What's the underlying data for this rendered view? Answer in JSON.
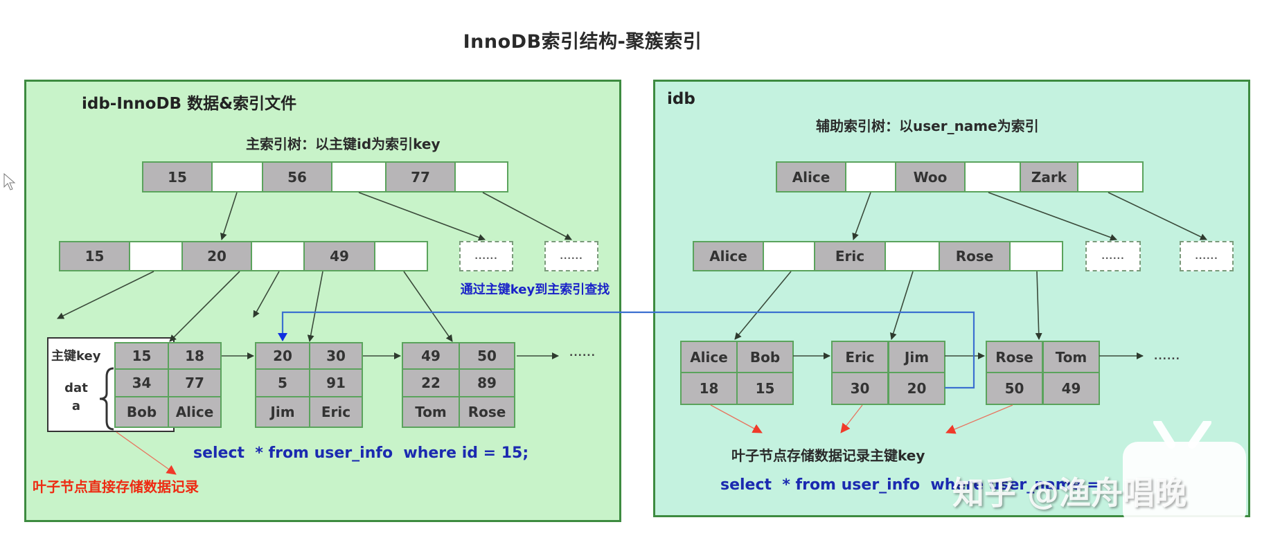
{
  "title": "InnoDB索引结构-聚簇索引",
  "left_panel": {
    "title": "idb-InnoDB 数据&索引文件",
    "subtitle": "主索引树：以主键id为索引key",
    "root_keys": [
      "15",
      "56",
      "77"
    ],
    "level2_keys": [
      "15",
      "20",
      "49"
    ],
    "placeholder_nodes": [
      "......",
      "......"
    ],
    "leaf_label_key": "主键key",
    "leaf_label_data": "dat\na",
    "leaves": [
      {
        "keys": [
          "15",
          "18"
        ],
        "row2": [
          "34",
          "77"
        ],
        "row3": [
          "Bob",
          "Alice"
        ]
      },
      {
        "keys": [
          "20",
          "30"
        ],
        "row2": [
          "5",
          "91"
        ],
        "row3": [
          "Jim",
          "Eric"
        ]
      },
      {
        "keys": [
          "49",
          "50"
        ],
        "row2": [
          "22",
          "89"
        ],
        "row3": [
          "Tom",
          "Rose"
        ]
      }
    ],
    "leaf_more": "......",
    "lookup_note": "通过主键key到主索引查找",
    "sql": "select  * from user_info  where id = 15;",
    "leaf_note": "叶子节点直接存储数据记录"
  },
  "right_panel": {
    "title": "idb",
    "subtitle": "辅助索引树：以user_name为索引",
    "root_keys": [
      "Alice",
      "Woo",
      "Zark"
    ],
    "level2_keys": [
      "Alice",
      "Eric",
      "Rose"
    ],
    "placeholder_nodes": [
      "......",
      "......"
    ],
    "leaves": [
      {
        "keys": [
          "Alice",
          "Bob"
        ],
        "pks": [
          "18",
          "15"
        ]
      },
      {
        "keys": [
          "Eric",
          "Jim"
        ],
        "pks": [
          "30",
          "20"
        ]
      },
      {
        "keys": [
          "Rose",
          "Tom"
        ],
        "pks": [
          "50",
          "49"
        ]
      }
    ],
    "leaf_more": "......",
    "leaf_note": "叶子节点存储数据记录主键key",
    "sql": "select  * from user_info  where user_name = "
  },
  "watermark": "知乎 @渔舟唱晚",
  "colors": {
    "left_bg": "#c8f3c9",
    "right_bg": "#c4f2df",
    "border": "#3d8b40",
    "key_cell": "#b7b5b7",
    "blue_link": "#1a22c8",
    "red_note": "#ee2a12"
  }
}
